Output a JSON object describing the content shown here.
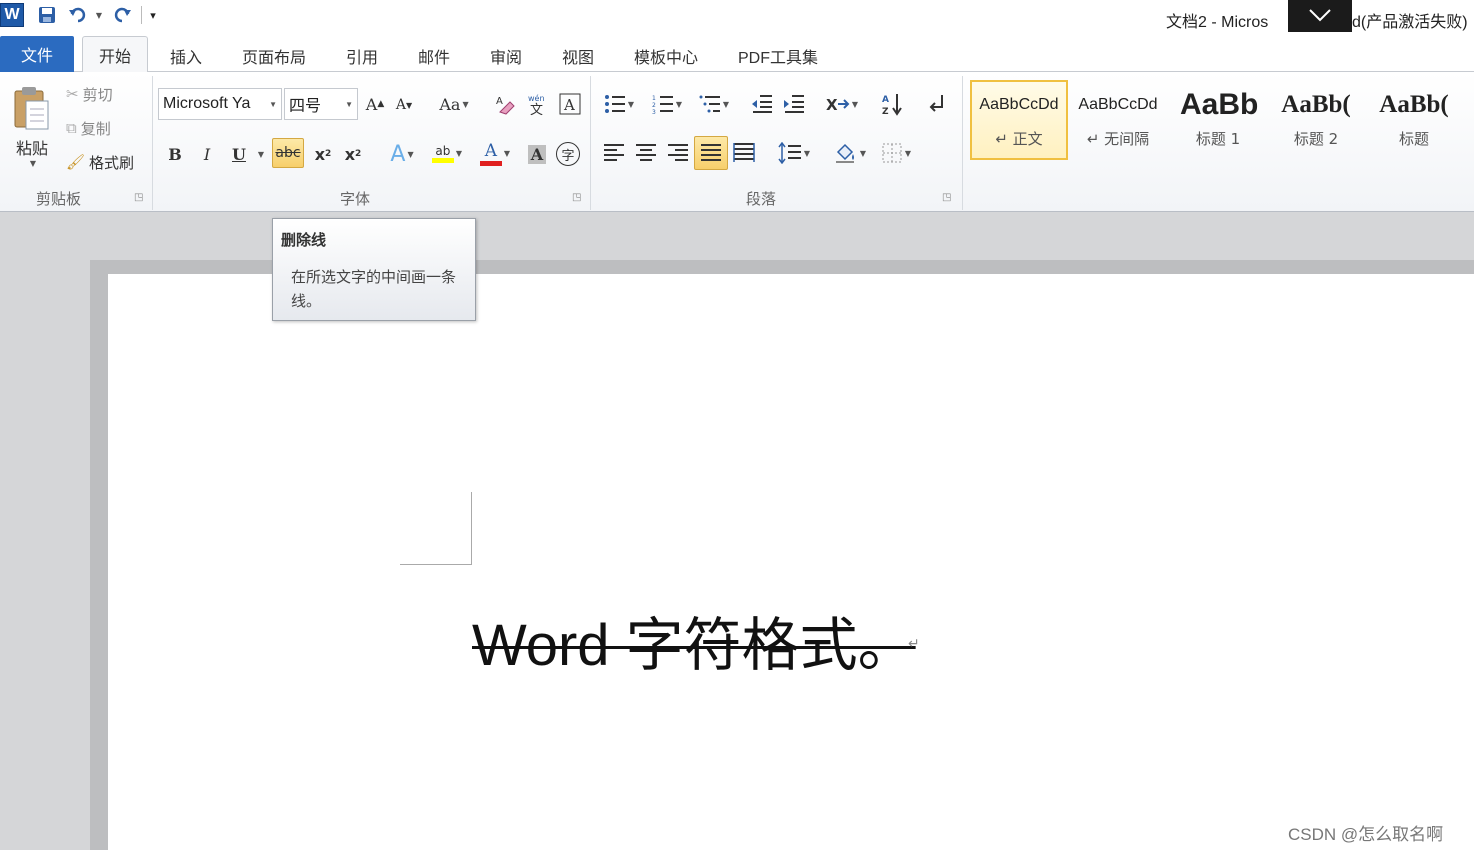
{
  "window": {
    "app_icon": "W",
    "title_left": "文档2  -  Micros",
    "title_right": "d(产品激活失败)"
  },
  "quick_access": {
    "save_icon": "save-icon",
    "undo_icon": "undo-icon",
    "redo_icon": "redo-icon",
    "customize_icon": "customize-icon"
  },
  "tabs": [
    {
      "label": "文件"
    },
    {
      "label": "开始"
    },
    {
      "label": "插入"
    },
    {
      "label": "页面布局"
    },
    {
      "label": "引用"
    },
    {
      "label": "邮件"
    },
    {
      "label": "审阅"
    },
    {
      "label": "视图"
    },
    {
      "label": "模板中心"
    },
    {
      "label": "PDF工具集"
    }
  ],
  "clipboard": {
    "paste_label": "粘贴",
    "cut_label": "剪切",
    "copy_label": "复制",
    "format_painter_label": "格式刷",
    "group_label": "剪贴板"
  },
  "font": {
    "font_name": "Microsoft Ya",
    "font_size": "四号",
    "grow_label": "A",
    "shrink_label": "A",
    "change_case_label": "Aa",
    "bold": "B",
    "italic": "I",
    "underline": "U",
    "strikethrough": "abc",
    "subscript": "x",
    "superscript": "x",
    "text_effects": "A",
    "highlight": "ab",
    "font_color": "A",
    "char_shading": "A",
    "enclose": "字",
    "group_label": "字体"
  },
  "paragraph": {
    "group_label": "段落"
  },
  "styles": [
    {
      "sample": "AaBbCcDd",
      "name": "↵ 正文"
    },
    {
      "sample": "AaBbCcDd",
      "name": "↵ 无间隔"
    },
    {
      "sample": "AaBb",
      "name": "标题 1"
    },
    {
      "sample": "AaBb(",
      "name": "标题 2"
    },
    {
      "sample": "AaBb(",
      "name": "标题"
    }
  ],
  "tooltip": {
    "title": "删除线",
    "body": "在所选文字的中间画一条线。"
  },
  "document": {
    "text": "Word 字符格式。",
    "paragraph_mark": "↵"
  },
  "watermark": "CSDN @怎么取名啊"
}
